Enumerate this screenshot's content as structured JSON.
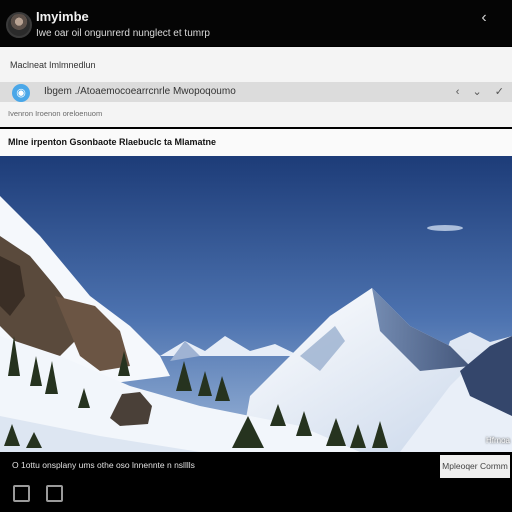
{
  "header": {
    "title": "Imyimbe",
    "subtitle": "Iwe oar oil ongunrerd nunglect et tumrp",
    "back_icon": "chevron-left-icon"
  },
  "panel": {
    "title": "Maclneat Imlmnedlun",
    "url_text": "Ibgem ./Atoaemocoearrcnrle Mwopoqoumo",
    "url_actions": [
      "‹",
      "⌄",
      "✓"
    ],
    "hint": "Ivenron Iroenon oreloenuom"
  },
  "post": {
    "title": "Mlne irpenton Gsonbaote Rlaebuclc ta Mlamatne",
    "photo_caption": "Hfrnoa",
    "alt_icon": "mountain-photo"
  },
  "footer": {
    "text": "O 1ottu onsplany ums othe oso lnnennte n nslllls",
    "comment_label": "Mpleoqer Cormm",
    "icons": [
      "square-icon",
      "edit-icon"
    ]
  },
  "colors": {
    "accent": "#4aa7e8",
    "header_bg": "#050505",
    "panel_bg": "#f4f4f4"
  }
}
